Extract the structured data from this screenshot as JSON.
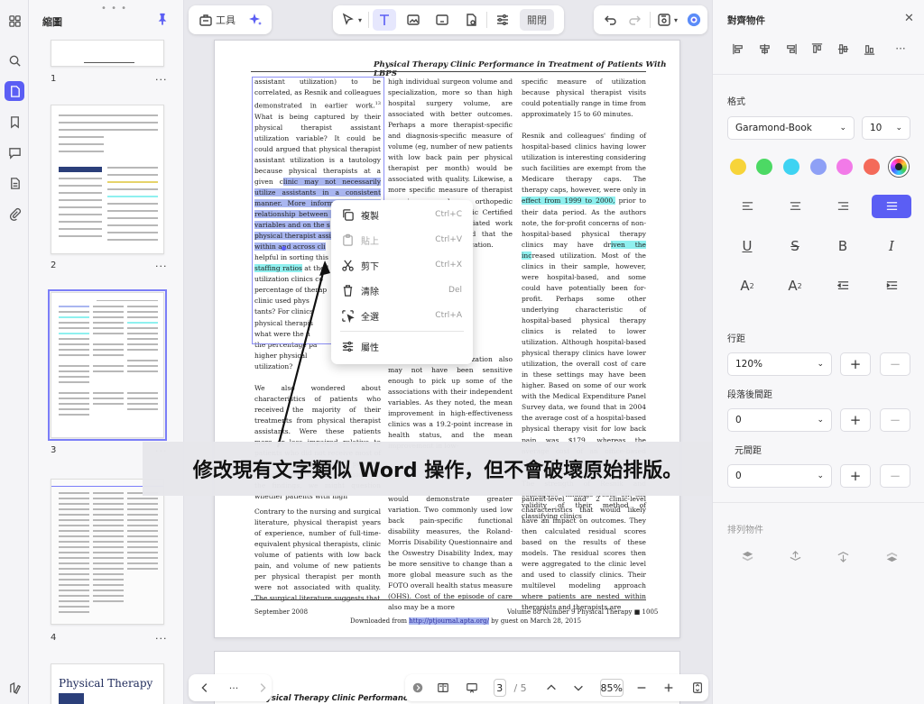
{
  "sidebar": {
    "title": "縮圖",
    "pages": [
      {
        "num": "1",
        "more": "···"
      },
      {
        "num": "2",
        "more": "···"
      },
      {
        "num": "3",
        "more": "···"
      },
      {
        "num": "4",
        "more": "···"
      }
    ],
    "thumb5_title": "Physical Therapy"
  },
  "toolbar": {
    "tools_label": "工具",
    "close_label": "關閉"
  },
  "document": {
    "header": "Physical Therapy Clinic Performance in Treatment of Patients With LBPS",
    "header_next": "Physical Therapy Clinic Performance in",
    "col1": [
      "assistant utilization) to be correlated, as Resnik and colleagues demonstrated in earlier work.",
      "13",
      " What is being captured by their physical therapist assistant utilization variable? It could be could argued that physical therapist assistant utilization is a tautology because physical therapists at a given c",
      "linic may not necessarily utilize assistants in a consistent manner. More information on the relationship between the staffing of",
      " ",
      "variables and on the s",
      "physical therapist assi",
      "within and across cli",
      "helpful in sorting this",
      "staffing ratios",
      " at the l",
      "utilization clinics co",
      "percentage of therap",
      "clinic used phys",
      "tants? For clinics",
      "physical therapis",
      "what were the n",
      "the percentage pa",
      "higher physical",
      "utilization?"
    ],
    "col1_rest": "We also wondered about characteristics of patients who received the majority of their treatments from physical therapist assistants. Were these patients more or less impaired relative to patients who did not receive most of their treatment from physical therapist assistants? Considering the findings, we might question whether patients with high",
    "col1_bottom": "Contrary to the nursing and surgical literature, physical therapist years of experience, number of full-time-equivalent physical therapists, clinic volume of patients with low back pain, and volume of new patients per physical therapist per month were not associated with quality. The surgical literature suggests that",
    "col2": "high individual surgeon volume and specialization, more so than high hospital surgery volume, are associated with better outcomes. Perhaps a more therapist-specific and diagnosis-specific measure of volume (eg, number of new patients with low back pain per physical therapist per month) would be associated with quality. Likewise, a more specific measure of therapist experience, such as orthopedic certification. Other clinic Certified of Orl Therapist associated work with certification noted that the data care from of certification.",
    "col2_mid": "effectiveness and utilization also may not have been sensitive enough to pick up some of the associations with their independent variables. As they noted, the mean improvement in high-effectiveness clinics was a 19.2-point increase in health status, and the mean improvement in low-",
    "col2_bottom": "would demonstrate greater variation. Two commonly used low back pain-specific functional disability measures, the Roland-Morris Disability Questionnaire and the Oswestry Disability Index, may be more sensitive to change than a more global measure such as the FOTO overall health status measure (OHS). Cost of the episode of care also may be a more",
    "col3": "specific measure of utilization because physical therapist visits could potentially range in time from approximately 15 to 60 minutes.",
    "col3_p2a": "Resnik and colleagues' finding of hospital-based clinics having lower utilization is interesting considering such facilities are exempt from the Medicare therapy caps. The therapy caps, however, were only in ",
    "col3_p2b": "effect from 1999 to 2000,",
    "col3_p2c": " prior to their data period. As the authors note, the for-profit concerns of non-hospital-based physical therapy clinics may have dr",
    "col3_p2d": "iven the inc",
    "col3_p2e": "reased utilization. Most of the clinics in their sample, however, were hospital-based, and some could have potentially been for-profit. Perhaps some other underlying characteristic of hospital-based physical therapy clinics is related to lower utilization. Although hospital-based physical therapy clinics have lower utilization, the overall cost of care in these settings may have been higher. Based on some of our work with the Medical Expenditure Panel Survey data, we found that in 2004 the average cost of a hospital-based physical therapy visit for low back pain was $179, whereas the average cost of an office-based physical therapy visit was $95.",
    "col3_p3": "The strength of Resnik and colleagues' findings rests on the validity of their method of classifying clinics",
    "col3_bottom": "patient-level and 2 clinic-level characteristics that would likely have an impact on outcomes. They then calculated residual scores based on the results of these models. The residual scores then were aggregated to the clinic level and used to classify clinics. Their multilevel modeling approach where patients are nested within therapists and therapists are",
    "footer_left": "September 2008",
    "footer_right": "Volume 88   Number 9   Physical Therapy   ■   1005",
    "download_pre": "Downloaded from ",
    "download_link": "http://ptjournal.apta.org/",
    "download_post": " by guest on March 28, 2015"
  },
  "context_menu": [
    {
      "label": "複製",
      "shortcut": "Ctrl+C",
      "icon": "copy-icon",
      "enabled": true
    },
    {
      "label": "貼上",
      "shortcut": "Ctrl+V",
      "icon": "paste-icon",
      "enabled": false
    },
    {
      "label": "剪下",
      "shortcut": "Ctrl+X",
      "icon": "scissors-icon",
      "enabled": true
    },
    {
      "label": "清除",
      "shortcut": "Del",
      "icon": "trash-icon",
      "enabled": true
    },
    {
      "label": "全選",
      "shortcut": "Ctrl+A",
      "icon": "select-all-icon",
      "enabled": true
    },
    {
      "label": "屬性",
      "shortcut": "",
      "icon": "sliders-icon",
      "enabled": true
    }
  ],
  "caption": "修改現有文字類似 Word 操作，但不會破壞原始排版。",
  "bottombar": {
    "more": "···",
    "page_current": "3",
    "page_total": "/ 5",
    "zoom": "85%"
  },
  "rightpanel": {
    "title": "對齊物件",
    "format_label": "格式",
    "font": "Garamond-Book",
    "font_size": "10",
    "colors": [
      "#f7d43a",
      "#4cd964",
      "#3ed3f2",
      "#8ea0f6",
      "#f27ae8",
      "#f46a5a"
    ],
    "line_spacing_label": "行距",
    "line_spacing": "120%",
    "paragraph_spacing_label": "段落後間距",
    "paragraph_spacing": "0",
    "char_spacing_label": "元間距",
    "char_spacing": "0",
    "arrange_label": "排列物件"
  }
}
